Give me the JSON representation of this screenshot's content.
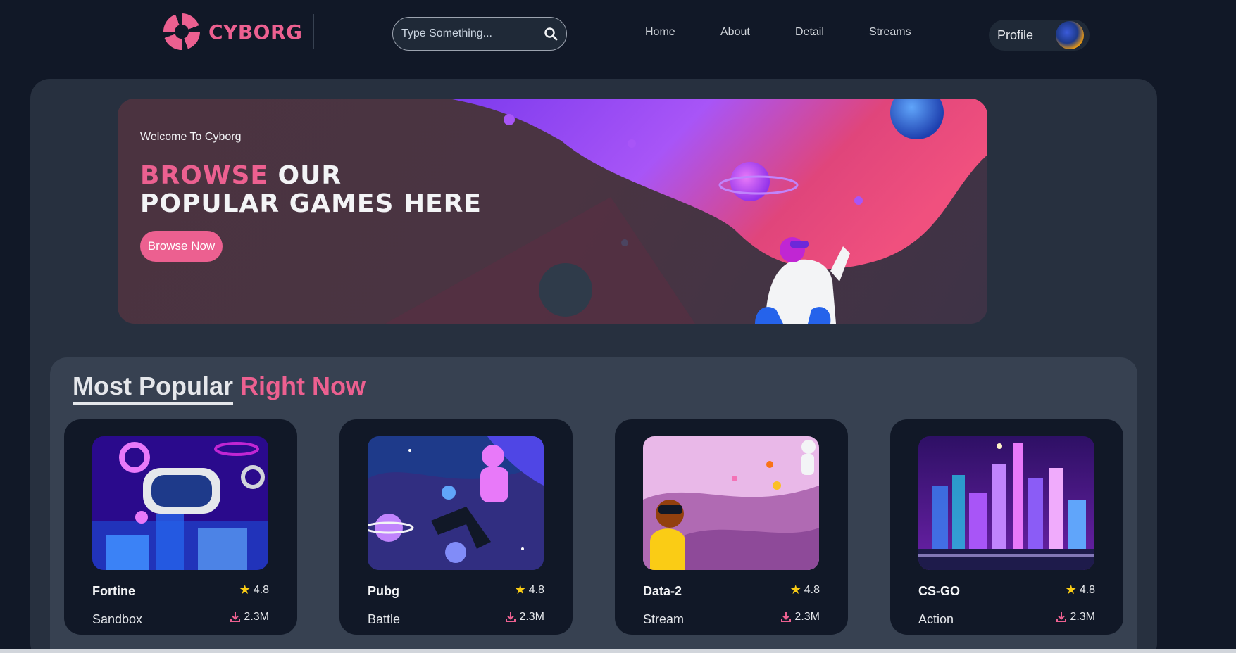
{
  "brand": {
    "name": "CYBORG",
    "color": "#ec6090"
  },
  "search": {
    "placeholder": "Type Something...",
    "icon": "search-icon"
  },
  "nav": {
    "items": [
      {
        "label": "Home"
      },
      {
        "label": "About"
      },
      {
        "label": "Detail"
      },
      {
        "label": "Streams"
      }
    ]
  },
  "profile": {
    "label": "Profile",
    "icon": "avatar"
  },
  "banner": {
    "welcome": "Welcome To Cyborg",
    "headline_accent": "BROWSE",
    "headline_rest_line1": "OUR",
    "headline_line2": "POPULAR GAMES HERE",
    "button_label": "Browse Now"
  },
  "popular": {
    "title_part1": "Most Popular",
    "title_part2": "Right Now",
    "cards": [
      {
        "name": "Fortine",
        "genre": "Sandbox",
        "rating": "4.8",
        "downloads": "2.3M"
      },
      {
        "name": "Pubg",
        "genre": "Battle",
        "rating": "4.8",
        "downloads": "2.3M"
      },
      {
        "name": "Data-2",
        "genre": "Stream",
        "rating": "4.8",
        "downloads": "2.3M"
      },
      {
        "name": "CS-GO",
        "genre": "Action",
        "rating": "4.8",
        "downloads": "2.3M"
      }
    ]
  },
  "colors": {
    "accent": "#ec6090",
    "background": "#111827",
    "panel": "#27303f",
    "section": "#374151",
    "star": "#facc15"
  }
}
